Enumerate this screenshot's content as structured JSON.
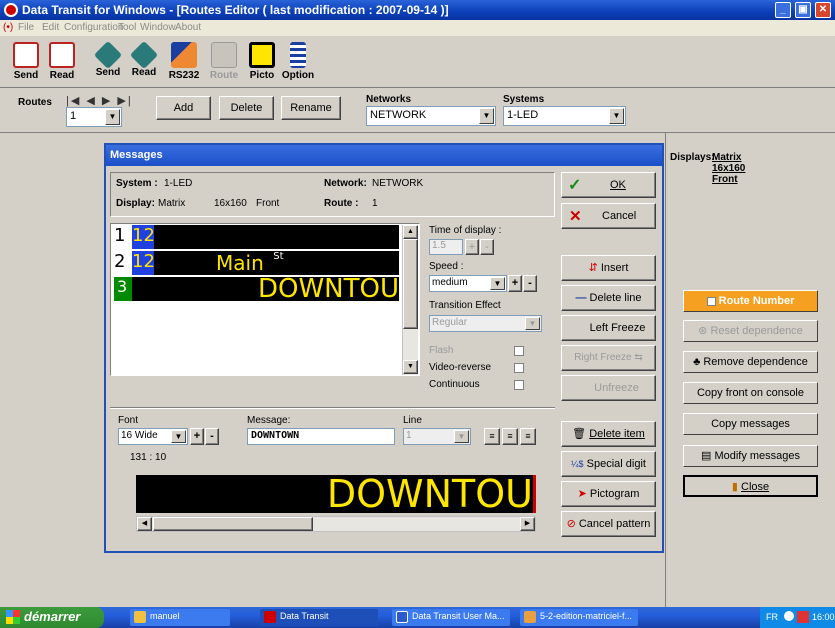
{
  "window": {
    "title": "Data Transit for Windows - [Routes Editor ( last modification : 2007-09-14 )]",
    "menu": [
      "File",
      "Edit",
      "Configuration",
      "Tool",
      "Window",
      "About"
    ]
  },
  "toolbar": {
    "buttons": [
      {
        "label": "Send",
        "icon": "send-icon"
      },
      {
        "label": "Read",
        "icon": "read-icon"
      },
      {
        "label": "Send",
        "icon": "send-satellite-icon"
      },
      {
        "label": "Read",
        "icon": "read-satellite-icon"
      },
      {
        "label": "RS232",
        "icon": "rs232-icon"
      },
      {
        "label": "Route",
        "icon": "route-icon"
      },
      {
        "label": "Picto",
        "icon": "picto-icon"
      },
      {
        "label": "Option",
        "icon": "option-icon"
      }
    ]
  },
  "routes_bar": {
    "routes_label": "Routes",
    "route_value": "1",
    "add_label": "Add",
    "delete_label": "Delete",
    "rename_label": "Rename",
    "networks_label": "Networks",
    "networks_value": "NETWORK",
    "systems_label": "Systems",
    "systems_value": "1-LED"
  },
  "right_panel": {
    "displays_label": "Displays:",
    "displays_value_1": "Matrix",
    "displays_value_2": "16x160",
    "displays_value_3": "Front",
    "route_number_label": "Route Number",
    "reset_dependence_label": "Reset dependence",
    "remove_dependence_label": "Remove dependence",
    "copy_front_label": "Copy front on console",
    "copy_messages_label": "Copy messages",
    "modify_messages_label": "Modify messages",
    "close_label": "Close"
  },
  "dialog": {
    "title": "Messages",
    "system_label": "System :",
    "system_value": "1-LED",
    "network_label": "Network:",
    "network_value": "NETWORK",
    "display_label": "Display:",
    "display_value": "Matrix",
    "display_size": "16x160",
    "display_side": "Front",
    "route_label": "Route :",
    "route_value": "1",
    "lines": [
      {
        "num": "1",
        "route": "123",
        "text": ""
      },
      {
        "num": "2",
        "route": "123",
        "text": "Main",
        "sup": "St"
      },
      {
        "num": "3",
        "route": "",
        "text": "DOWNTOU"
      }
    ],
    "time_of_display_label": "Time of display :",
    "time_of_display_value": "1.5",
    "speed_label": "Speed :",
    "speed_value": "medium",
    "transition_label": "Transition Effect",
    "transition_value": "Regular",
    "flash_label": "Flash",
    "video_reverse_label": "Video-reverse",
    "continuous_label": "Continuous",
    "ok_label": "OK",
    "cancel_label": "Cancel",
    "insert_label": "Insert",
    "delete_line_label": "Delete line",
    "left_freeze_label": "Left Freeze",
    "right_freeze_label": "Right Freeze",
    "unfreeze_label": "Unfreeze",
    "font_label": "Font",
    "font_value": "16 Wide",
    "message_label": "Message:",
    "message_value": "DOWNTOWN",
    "line_label": "Line",
    "line_value": "1",
    "position": "131 : 10",
    "preview_text": "DOWNTOU",
    "delete_item_label": "Delete item",
    "special_digit_label": "Special digit",
    "pictogram_label": "Pictogram",
    "cancel_pattern_label": "Cancel pattern"
  },
  "taskbar": {
    "start_label": "démarrer",
    "tasks": [
      "manuel",
      "Data Transit",
      "Data Transit User Ma...",
      "5-2-edition-matriciel-f..."
    ],
    "lang": "FR",
    "clock": "16:00"
  },
  "colors": {
    "led_yellow": "#ffe600",
    "route_blue": "#2040e0",
    "line_green": "#008a00",
    "route_number_orange": "#f5a020"
  }
}
